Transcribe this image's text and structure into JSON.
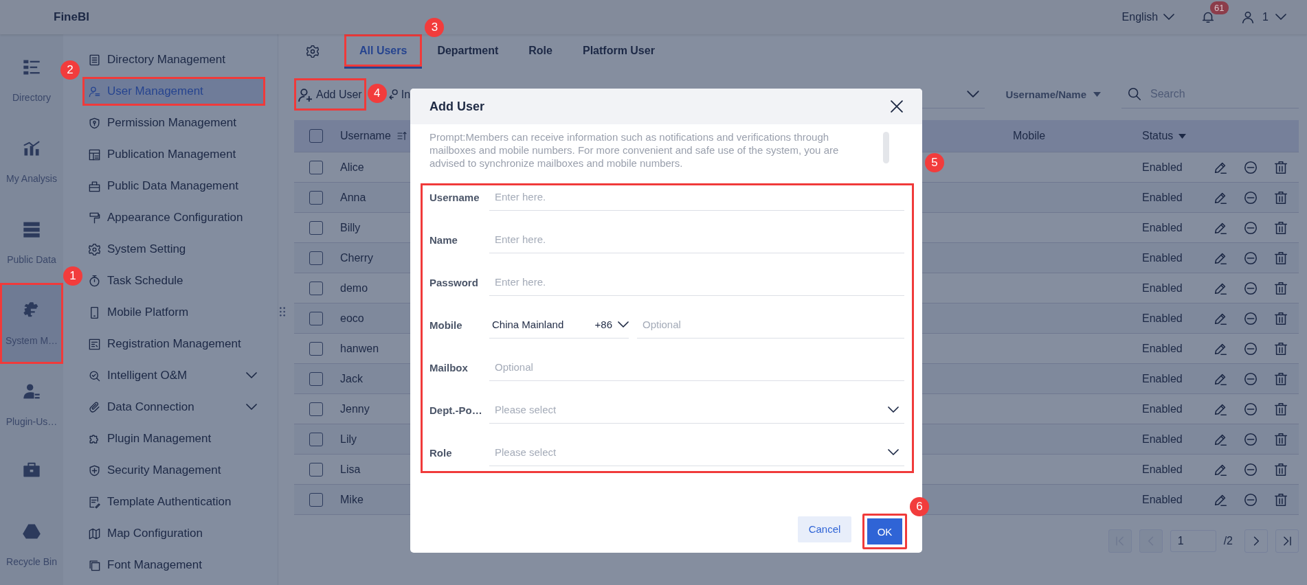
{
  "app": {
    "title": "FineBI",
    "language": "English",
    "notification_count": "61",
    "user": "1"
  },
  "nav_rail": [
    {
      "label": "Directory",
      "selected": false,
      "highlighted": false
    },
    {
      "label": "My Analysis",
      "selected": false,
      "highlighted": false
    },
    {
      "label": "Public Data",
      "selected": false,
      "highlighted": false
    },
    {
      "label": "System M…",
      "selected": true,
      "highlighted": true,
      "marker": "1"
    },
    {
      "label": "Plugin-Us…",
      "selected": false,
      "highlighted": false
    },
    {
      "selected": false,
      "highlighted": false
    },
    {
      "label": "Recycle Bin",
      "selected": false,
      "highlighted": false
    }
  ],
  "menu": [
    {
      "label": "Directory Management",
      "kind": "page",
      "selected": false,
      "highlighted": false
    },
    {
      "label": "User Management",
      "kind": "page",
      "selected": true,
      "highlighted": true,
      "marker": "2"
    },
    {
      "label": "Permission Management",
      "kind": "page",
      "selected": false,
      "highlighted": false
    },
    {
      "label": "Publication Management",
      "kind": "page",
      "selected": false,
      "highlighted": false
    },
    {
      "label": "Public Data Management",
      "kind": "page",
      "selected": false,
      "highlighted": false
    },
    {
      "label": "Appearance Configuration",
      "kind": "page",
      "selected": false,
      "highlighted": false
    },
    {
      "label": "System Setting",
      "kind": "page",
      "selected": false,
      "highlighted": false
    },
    {
      "label": "Task Schedule",
      "kind": "page",
      "selected": false,
      "highlighted": false
    },
    {
      "label": "Mobile Platform",
      "kind": "page",
      "selected": false,
      "highlighted": false
    },
    {
      "label": "Registration Management",
      "kind": "page",
      "selected": false,
      "highlighted": false
    },
    {
      "label": "Intelligent O&M",
      "kind": "group",
      "selected": false,
      "highlighted": false
    },
    {
      "label": "Data Connection",
      "kind": "group",
      "selected": false,
      "highlighted": false
    },
    {
      "label": "Plugin Management",
      "kind": "page",
      "selected": false,
      "highlighted": false
    },
    {
      "label": "Security Management",
      "kind": "page",
      "selected": false,
      "highlighted": false
    },
    {
      "label": "Template Authentication",
      "kind": "page",
      "selected": false,
      "highlighted": false
    },
    {
      "label": "Map Configuration",
      "kind": "page",
      "selected": false,
      "highlighted": false
    },
    {
      "label": "Font Management",
      "kind": "page",
      "selected": false,
      "highlighted": false
    }
  ],
  "tabs": [
    {
      "label": "All Users",
      "selected": true,
      "highlighted": true,
      "marker": "3"
    },
    {
      "label": "Department",
      "selected": false,
      "highlighted": false
    },
    {
      "label": "Role",
      "selected": false,
      "highlighted": false
    },
    {
      "label": "Platform User",
      "selected": false,
      "highlighted": false
    }
  ],
  "toolbar": {
    "buttons": [
      {
        "label": "Add User",
        "highlighted": true,
        "marker": "4"
      },
      {
        "label": "In",
        "highlighted": false
      }
    ],
    "search_scope": "Username/Name",
    "search": {
      "placeholder": "Search"
    }
  },
  "table": {
    "select_all": {
      "checked": false
    },
    "columns": [
      "Username",
      "Mobile",
      "Status"
    ],
    "rows": [
      {
        "username": "Alice",
        "status": "Enabled",
        "checked": false
      },
      {
        "username": "Anna",
        "status": "Enabled",
        "checked": false
      },
      {
        "username": "Billy",
        "status": "Enabled",
        "checked": false
      },
      {
        "username": "Cherry",
        "status": "Enabled",
        "checked": false
      },
      {
        "username": "demo",
        "status": "Enabled",
        "checked": false
      },
      {
        "username": "eoco",
        "status": "Enabled",
        "checked": false
      },
      {
        "username": "hanwen",
        "status": "Enabled",
        "checked": false
      },
      {
        "username": "Jack",
        "status": "Enabled",
        "checked": false
      },
      {
        "username": "Jenny",
        "status": "Enabled",
        "checked": false
      },
      {
        "username": "Lily",
        "status": "Enabled",
        "checked": false
      },
      {
        "username": "Lisa",
        "status": "Enabled",
        "checked": false
      },
      {
        "username": "Mike",
        "status": "Enabled",
        "checked": false
      }
    ]
  },
  "pagination": {
    "page": "1",
    "total": "/2",
    "buttons": [
      {
        "kind": "first",
        "disabled": true
      },
      {
        "kind": "prev",
        "disabled": true
      },
      {
        "kind": "next",
        "disabled": false
      },
      {
        "kind": "last",
        "disabled": false
      }
    ]
  },
  "dialog": {
    "title": "Add User",
    "prompt": "Prompt:Members can receive information such as notifications and verifications through mailboxes and mobile numbers. For more convenient and safe use of the system, you are advised to synchronize mailboxes and mobile numbers.",
    "highlighted": true,
    "marker": "5",
    "fields": [
      {
        "label": "Username",
        "kind": "text",
        "placeholder": "Enter here."
      },
      {
        "label": "Name",
        "kind": "text",
        "placeholder": "Enter here."
      },
      {
        "label": "Password",
        "kind": "text",
        "placeholder": "Enter here."
      },
      {
        "label": "Mobile",
        "kind": "phone",
        "region": "China Mainland",
        "code": "+86",
        "placeholder": "Optional"
      },
      {
        "label": "Mailbox",
        "kind": "text",
        "placeholder": "Optional"
      },
      {
        "label": "Dept.-Po…",
        "kind": "select",
        "placeholder": "Please select"
      },
      {
        "label": "Role",
        "kind": "select",
        "placeholder": "Please select"
      }
    ],
    "buttons": [
      {
        "label": "Cancel",
        "kind": "secondary",
        "highlighted": false
      },
      {
        "label": "OK",
        "kind": "primary",
        "highlighted": true,
        "marker": "6"
      }
    ]
  }
}
